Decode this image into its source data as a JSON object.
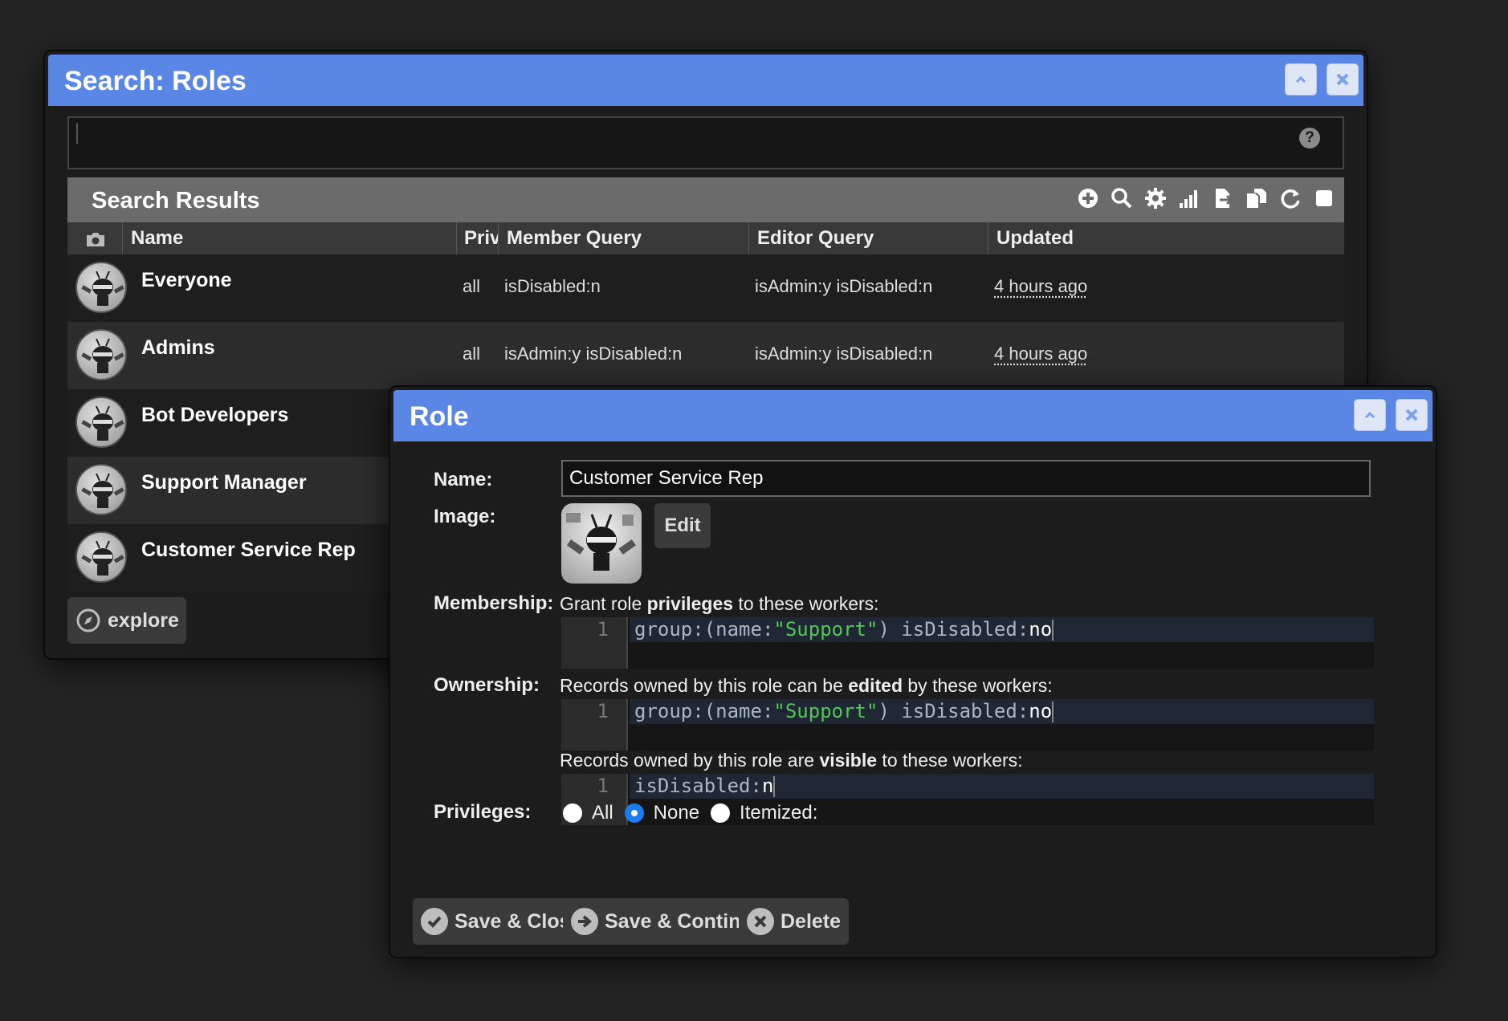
{
  "search_window": {
    "title": "Search: Roles",
    "search_value": "",
    "help_glyph": "?",
    "results_title": "Search Results",
    "toolbar_icons": [
      "add-icon",
      "search-icon",
      "gear-icon",
      "signal-bars-icon",
      "export-icon",
      "copy-icon",
      "refresh-icon",
      "select-all-icon"
    ],
    "columns": [
      "Name",
      "Privi",
      "Member Query",
      "Editor Query",
      "Updated"
    ],
    "rows": [
      {
        "name": "Everyone",
        "privileges": "all",
        "member_query": "isDisabled:n",
        "editor_query": "isAdmin:y isDisabled:n",
        "updated": "4 hours ago"
      },
      {
        "name": "Admins",
        "privileges": "all",
        "member_query": "isAdmin:y isDisabled:n",
        "editor_query": "isAdmin:y isDisabled:n",
        "updated": "4 hours ago"
      },
      {
        "name": "Bot Developers"
      },
      {
        "name": "Support Manager"
      },
      {
        "name": "Customer Service Rep"
      }
    ],
    "explore_label": "explore"
  },
  "role_window": {
    "title": "Role",
    "name_label": "Name:",
    "name_value": "Customer Service Rep",
    "image_label": "Image:",
    "edit_label": "Edit",
    "membership_label": "Membership:",
    "membership_desc": {
      "pre": "Grant role ",
      "bold": "privileges",
      "post": " to these workers:"
    },
    "membership_query": {
      "line": "1",
      "key": "group:(name:",
      "str": "\"Support\"",
      "mid": ") isDisabled:",
      "val": "no"
    },
    "ownership_label": "Ownership:",
    "ownership_edit_desc": {
      "pre": "Records owned by this role can be ",
      "bold": "edited",
      "post": " by these workers:"
    },
    "ownership_edit_query": {
      "line": "1",
      "key": "group:(name:",
      "str": "\"Support\"",
      "mid": ") isDisabled:",
      "val": "no"
    },
    "ownership_visible_desc": {
      "pre": "Records owned by this role are ",
      "bold": "visible",
      "post": " to these workers:"
    },
    "ownership_visible_query": {
      "line": "1",
      "key": "isDisabled:",
      "val": "n"
    },
    "privileges_label": "Privileges:",
    "privileges_options": [
      "All",
      "None",
      "Itemized:"
    ],
    "privileges_selected": "None",
    "buttons": {
      "save_close": "Save & Close",
      "save_continue": "Save & Continue",
      "delete": "Delete"
    }
  },
  "colors": {
    "titlebar": "#5a86e6",
    "radio_checked": "#1d7bf0",
    "string_literal": "#4fc94f"
  }
}
